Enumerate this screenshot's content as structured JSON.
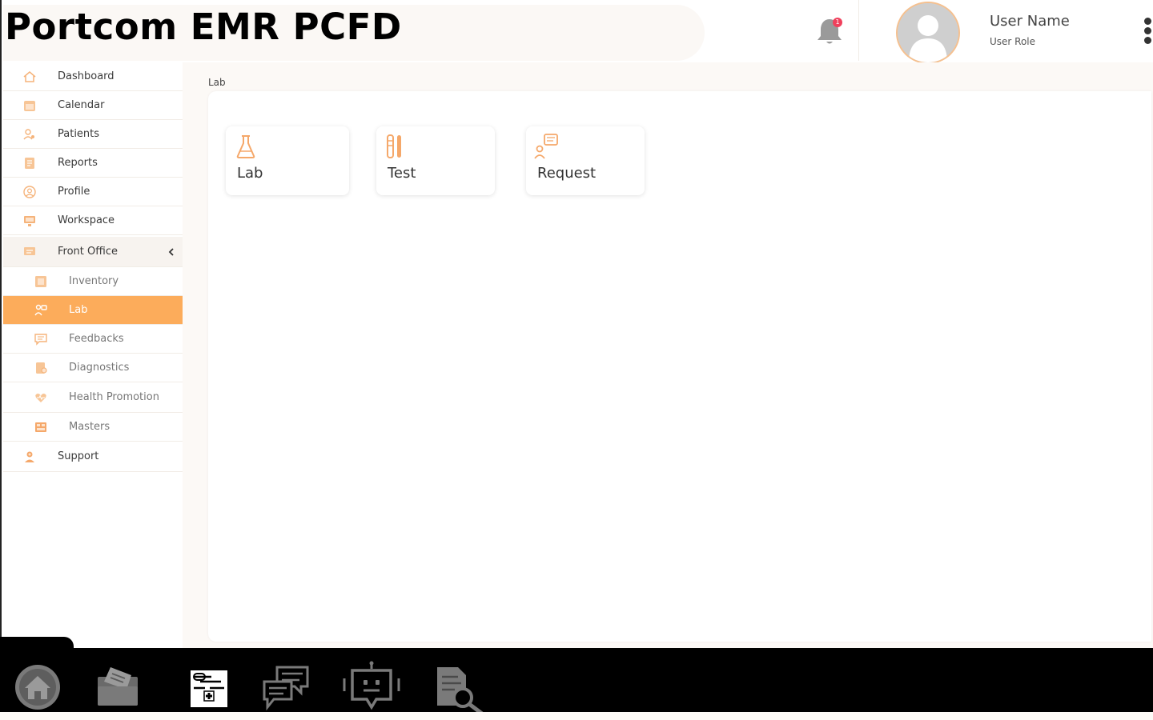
{
  "app": {
    "title": "Portcom EMR PCFD"
  },
  "header": {
    "notification_count": "1",
    "user_name": "User Name",
    "user_role": "User Role"
  },
  "sidebar": {
    "items": [
      {
        "label": "Dashboard",
        "icon": "home-icon"
      },
      {
        "label": "Calendar",
        "icon": "calendar-icon"
      },
      {
        "label": "Patients",
        "icon": "patients-icon"
      },
      {
        "label": "Reports",
        "icon": "reports-icon"
      },
      {
        "label": "Profile",
        "icon": "profile-icon"
      },
      {
        "label": "Workspace",
        "icon": "monitor-icon"
      },
      {
        "label": "Front Office",
        "icon": "front-office-icon",
        "expanded": true
      },
      {
        "label": "Inventory",
        "icon": "inventory-icon"
      },
      {
        "label": "Lab",
        "icon": "lab-icon",
        "active": true
      },
      {
        "label": "Feedbacks",
        "icon": "feedback-icon"
      },
      {
        "label": "Diagnostics",
        "icon": "diagnostics-icon"
      },
      {
        "label": "Health Promotion",
        "icon": "health-promotion-icon"
      },
      {
        "label": "Masters",
        "icon": "masters-icon"
      },
      {
        "label": "Support",
        "icon": "support-icon"
      }
    ]
  },
  "main": {
    "breadcrumb": "Lab",
    "cards": [
      {
        "label": "Lab",
        "icon": "flask-icon"
      },
      {
        "label": "Test",
        "icon": "test-tubes-icon"
      },
      {
        "label": "Request",
        "icon": "request-icon"
      }
    ]
  },
  "bottom_bar": {
    "icons": [
      "home-icon",
      "files-icon",
      "medical-record-icon",
      "chat-icon",
      "chatbot-icon",
      "document-search-icon"
    ]
  },
  "colors": {
    "accent": "#fcac5b",
    "accent_light": "#f5c08f",
    "badge": "#f0405c",
    "background": "#fcf9f6"
  }
}
